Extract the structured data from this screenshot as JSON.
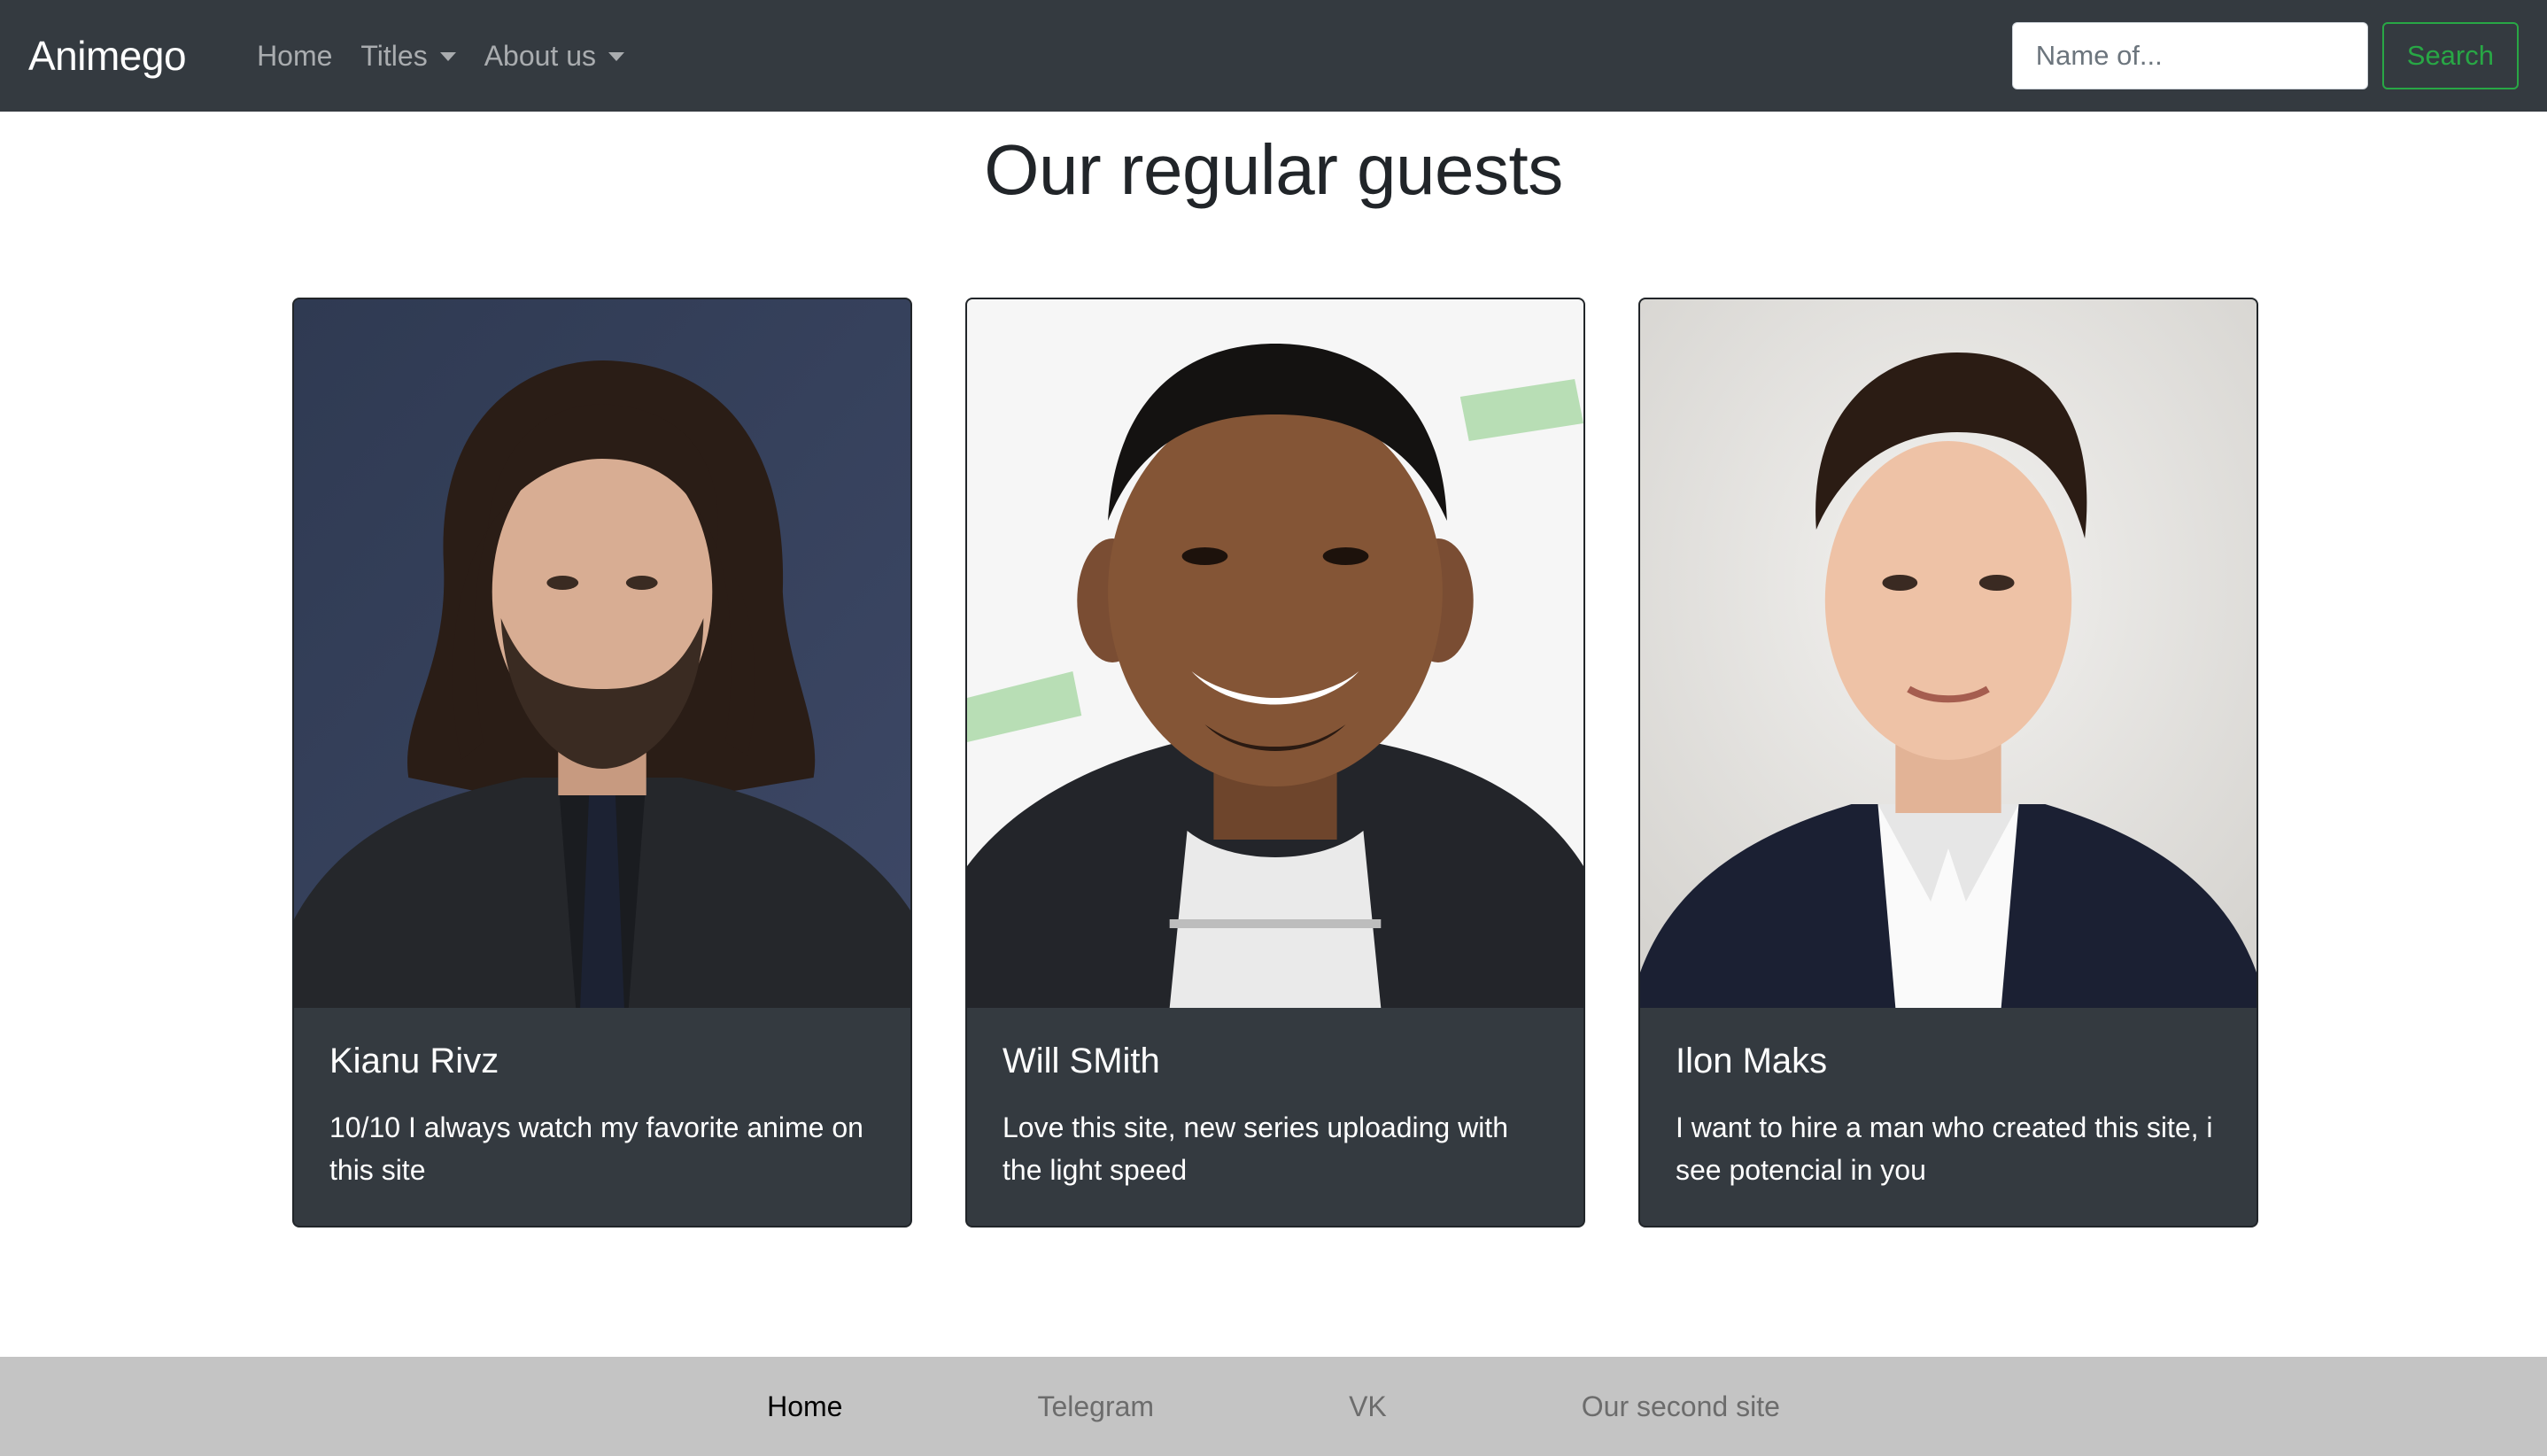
{
  "navbar": {
    "brand": "Animego",
    "links": [
      {
        "label": "Home",
        "dropdown": false
      },
      {
        "label": "Titles",
        "dropdown": true
      },
      {
        "label": "About us",
        "dropdown": true
      }
    ],
    "search": {
      "placeholder": "Name of...",
      "value": "",
      "button_label": "Search"
    }
  },
  "main": {
    "title": "Our regular guests",
    "cards": [
      {
        "name": "Kianu Rivz",
        "text": "10/10 I always watch my favorite anime on this site",
        "photo": "portrait-photo-long-dark-hair"
      },
      {
        "name": "Will SMith",
        "text": "Love this site, new series uploading with the light speed",
        "photo": "portrait-photo-smiling-man"
      },
      {
        "name": "Ilon Maks",
        "text": "I want to hire a man who created this site, i see potencial in you",
        "photo": "portrait-photo-man-in-suit"
      }
    ]
  },
  "footer": {
    "links": [
      {
        "label": "Home",
        "active": true
      },
      {
        "label": "Telegram",
        "active": false
      },
      {
        "label": "VK",
        "active": false
      },
      {
        "label": "Our second site",
        "active": false
      }
    ]
  },
  "colors": {
    "navbar_bg": "#343a40",
    "card_bg": "#343a40",
    "search_button": "#28a745",
    "footer_bg": "#c4c4c4"
  }
}
